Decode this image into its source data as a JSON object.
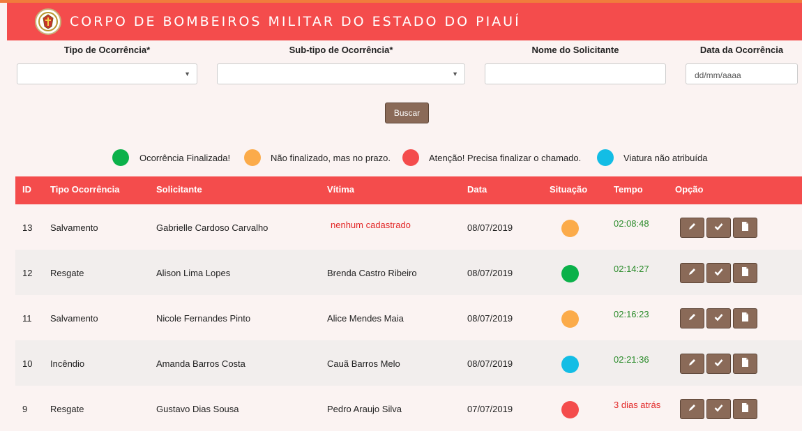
{
  "colors": {
    "accent": "#f44c4c",
    "button": "#8a6a58",
    "green": "#0bb14a",
    "orange": "#fbab4a",
    "red": "#f44c4c",
    "blue": "#13bde5",
    "time_ok": "#2a8b2a",
    "time_late": "#e32a2a"
  },
  "header": {
    "title": "CORPO DE BOMBEIROS MILITAR DO ESTADO DO PIAUÍ",
    "logo_icon": "fire-department-emblem-icon"
  },
  "filters": {
    "tipo_label": "Tipo de Ocorrência*",
    "subtipo_label": "Sub-tipo de Ocorrência*",
    "nome_label": "Nome do Solicitante",
    "data_label": "Data da Ocorrência",
    "tipo_value": "",
    "subtipo_value": "",
    "nome_value": "",
    "data_value": "dd/mm/aaaa",
    "search_label": "Buscar"
  },
  "legend": [
    {
      "color": "#0bb14a",
      "label": "Ocorrência Finalizada!"
    },
    {
      "color": "#fbab4a",
      "label": "Não finalizado, mas no prazo."
    },
    {
      "color": "#f44c4c",
      "label": "Atenção! Precisa finalizar o chamado."
    },
    {
      "color": "#13bde5",
      "label": "Viatura não atribuída"
    }
  ],
  "table": {
    "headers": {
      "id": "ID",
      "tipo": "Tipo Ocorrência",
      "solicitante": "Solicitante",
      "vitima": "Vítima",
      "data": "Data",
      "situacao": "Situação",
      "tempo": "Tempo",
      "opcao": "Opção"
    },
    "option_icons": [
      "pencil-icon",
      "check-icon",
      "file-icon"
    ],
    "rows": [
      {
        "id": "13",
        "tipo": "Salvamento",
        "solicitante": "Gabrielle Cardoso Carvalho",
        "vitima": "nenhum cadastrado",
        "vitima_missing": true,
        "data": "08/07/2019",
        "situacao": "orange",
        "tempo": "02:08:48",
        "tempo_late": false
      },
      {
        "id": "12",
        "tipo": "Resgate",
        "solicitante": "Alison Lima Lopes",
        "vitima": "Brenda Castro Ribeiro",
        "vitima_missing": false,
        "data": "08/07/2019",
        "situacao": "green",
        "tempo": "02:14:27",
        "tempo_late": false
      },
      {
        "id": "11",
        "tipo": "Salvamento",
        "solicitante": "Nicole Fernandes Pinto",
        "vitima": "Alice Mendes Maia",
        "vitima_missing": false,
        "data": "08/07/2019",
        "situacao": "orange",
        "tempo": "02:16:23",
        "tempo_late": false
      },
      {
        "id": "10",
        "tipo": "Incêndio",
        "solicitante": "Amanda Barros Costa",
        "vitima": "Cauã Barros Melo",
        "vitima_missing": false,
        "data": "08/07/2019",
        "situacao": "blue",
        "tempo": "02:21:36",
        "tempo_late": false
      },
      {
        "id": "9",
        "tipo": "Resgate",
        "solicitante": "Gustavo Dias Sousa",
        "vitima": "Pedro Araujo Silva",
        "vitima_missing": false,
        "data": "07/07/2019",
        "situacao": "red",
        "tempo": "3 dias atrás",
        "tempo_late": true
      }
    ]
  }
}
